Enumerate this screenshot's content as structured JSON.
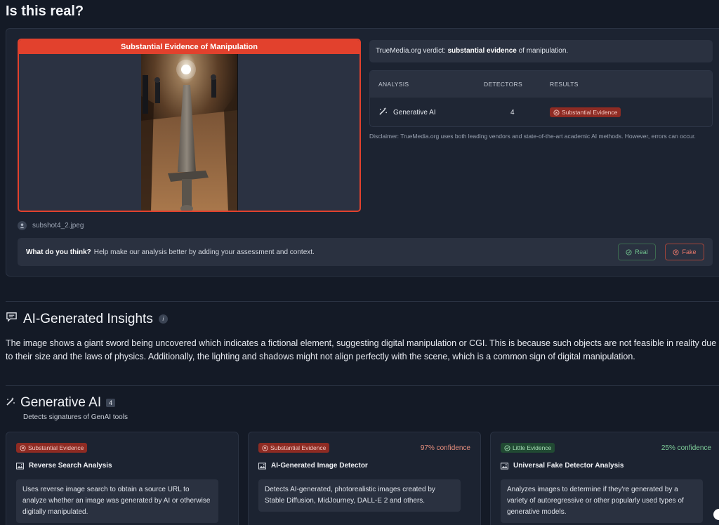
{
  "page": {
    "title": "Is this real?"
  },
  "media": {
    "banner": "Substantial Evidence of Manipulation",
    "filename": "subshot4_2.jpeg"
  },
  "verdict": {
    "prefix": "TrueMedia.org verdict: ",
    "strong": "substantial evidence",
    "suffix": " of manipulation."
  },
  "analysis_table": {
    "headers": [
      "ANALYSIS",
      "DETECTORS",
      "RESULTS"
    ],
    "rows": [
      {
        "analysis": "Generative AI",
        "detectors": "4",
        "result": "Substantial Evidence"
      }
    ]
  },
  "disclaimer": "Disclaimer: TrueMedia.org uses both leading vendors and state-of-the-art academic AI methods. However, errors can occur.",
  "feedback": {
    "question": "What do you think?",
    "prompt": "Help make our analysis better by adding your assessment and context.",
    "real_label": "Real",
    "fake_label": "Fake"
  },
  "insights": {
    "title": "AI-Generated Insights",
    "text": "The image shows a giant sword being uncovered which indicates a fictional element, suggesting digital manipulation or CGI. This is because such objects are not feasible in reality due to their size and the laws of physics. Additionally, the lighting and shadows might not align perfectly with the scene, which is a common sign of digital manipulation."
  },
  "generative_ai": {
    "title": "Generative AI",
    "count": "4",
    "subtitle": "Detects signatures of GenAI tools",
    "detectors": [
      {
        "badge": "Substantial Evidence",
        "confidence": "",
        "name": "Reverse Search Analysis",
        "description": "Uses reverse image search to obtain a source URL to analyze whether an image was generated by AI or otherwise digitally manipulated."
      },
      {
        "badge": "Substantial Evidence",
        "confidence": "97% confidence",
        "name": "AI-Generated Image Detector",
        "description": "Detects AI-generated, photorealistic images created by Stable Diffusion, MidJourney, DALL-E 2 and others."
      },
      {
        "badge": "Little Evidence",
        "confidence": "25% confidence",
        "name": "Universal Fake Detector Analysis",
        "description": "Analyzes images to determine if they're generated by a variety of autoregressive or other popularly used types of generative models."
      }
    ]
  },
  "colors": {
    "background": "#141a26",
    "card": "#1c2331",
    "danger": "#e2412d",
    "danger_badge": "#8e2b23",
    "success_badge": "#214a33"
  },
  "icons": {
    "user": "user-circle-icon",
    "magic_wand": "magic-wand-icon",
    "chat": "chat-bubble-icon",
    "info": "info-icon",
    "image": "image-icon",
    "x_circle": "x-circle-icon",
    "check_circle": "check-circle-icon"
  }
}
